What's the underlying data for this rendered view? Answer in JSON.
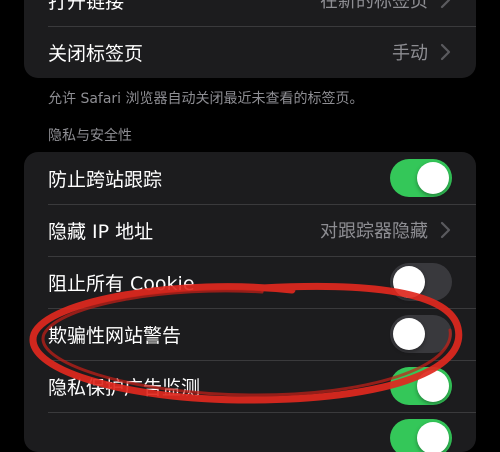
{
  "tabs_group": {
    "open_links": {
      "label": "打开链接",
      "value": "在新的标签页"
    },
    "close_tabs": {
      "label": "关闭标签页",
      "value": "手动"
    }
  },
  "close_tabs_footer": "允许 Safari 浏览器自动关闭最近未查看的标签页。",
  "privacy_section": {
    "header": "隐私与安全性",
    "items": [
      {
        "label": "防止跨站跟踪",
        "type": "toggle",
        "on": true
      },
      {
        "label": "隐藏 IP 地址",
        "type": "link",
        "value": "对跟踪器隐藏"
      },
      {
        "label": "阻止所有 Cookie",
        "type": "toggle",
        "on": false
      },
      {
        "label": "欺骗性网站警告",
        "type": "toggle",
        "on": false
      },
      {
        "label": "隐私保护广告监测",
        "type": "toggle",
        "on": true
      }
    ]
  },
  "colors": {
    "toggle_on": "#34c759",
    "toggle_off": "#39393d",
    "annotation": "#e0281e"
  },
  "annotation": "red-ellipse-circling-fraud-warning"
}
